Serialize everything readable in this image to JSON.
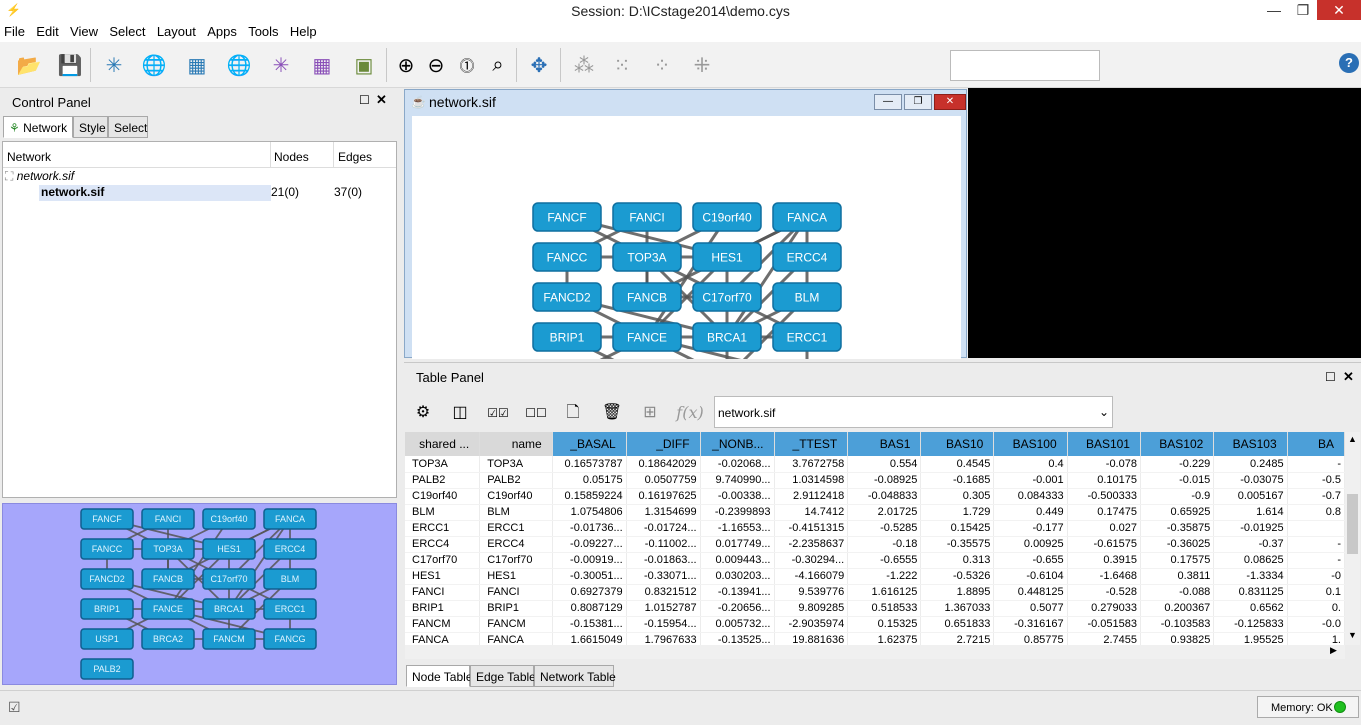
{
  "window": {
    "title": "Session: D:\\ICstage2014\\demo.cys"
  },
  "menubar": [
    "File",
    "Edit",
    "View",
    "Select",
    "Layout",
    "Apps",
    "Tools",
    "Help"
  ],
  "control_panel": {
    "title": "Control Panel",
    "tabs": [
      "Network",
      "Style",
      "Select"
    ],
    "columns": [
      "Network",
      "Nodes",
      "Edges"
    ],
    "collection_name": "network.sif",
    "network_name": "network.sif",
    "nodes": "21(0)",
    "edges": "37(0)"
  },
  "network_window": {
    "title": "network.sif"
  },
  "nodes": [
    "FANCF",
    "FANCI",
    "C19orf40",
    "FANCA",
    "FANCC",
    "TOP3A",
    "HES1",
    "ERCC4",
    "FANCD2",
    "FANCB",
    "C17orf70",
    "BLM",
    "BRIP1",
    "FANCE",
    "BRCA1",
    "ERCC1",
    "USP1",
    "BRCA2",
    "FANCM",
    "FANCG",
    "PALB2"
  ],
  "table_panel": {
    "title": "Table Panel",
    "selected_table": "network.sif",
    "function_label": "f(x)",
    "columns": [
      "shared ...",
      "name",
      "_BASAL",
      "_DIFF",
      "_NONB...",
      "_TTEST",
      "BAS1",
      "BAS10",
      "BAS100",
      "BAS101",
      "BAS102",
      "BAS103",
      "BA"
    ],
    "rows": [
      [
        "TOP3A",
        "TOP3A",
        "0.16573787",
        "0.18642029",
        "-0.02068...",
        "3.7672758",
        "0.554",
        "0.4545",
        "0.4",
        "-0.078",
        "-0.229",
        "0.2485",
        "-"
      ],
      [
        "PALB2",
        "PALB2",
        "0.05175",
        "0.0507759",
        "9.740990...",
        "1.0314598",
        "-0.08925",
        "-0.1685",
        "-0.001",
        "0.10175",
        "-0.015",
        "-0.03075",
        "-0.5"
      ],
      [
        "C19orf40",
        "C19orf40",
        "0.15859224",
        "0.16197625",
        "-0.00338...",
        "2.9112418",
        "-0.048833",
        "0.305",
        "0.084333",
        "-0.500333",
        "-0.9",
        "0.005167",
        "-0.7"
      ],
      [
        "BLM",
        "BLM",
        "1.0754806",
        "1.3154699",
        "-0.2399893",
        "14.7412",
        "2.01725",
        "1.729",
        "0.449",
        "0.17475",
        "0.65925",
        "1.614",
        "0.8"
      ],
      [
        "ERCC1",
        "ERCC1",
        "-0.01736...",
        "-0.01724...",
        "-1.16553...",
        "-0.4151315",
        "-0.5285",
        "0.15425",
        "-0.177",
        "0.027",
        "-0.35875",
        "-0.01925",
        ""
      ],
      [
        "ERCC4",
        "ERCC4",
        "-0.09227...",
        "-0.11002...",
        "0.017749...",
        "-2.2358637",
        "-0.18",
        "-0.35575",
        "0.00925",
        "-0.61575",
        "-0.36025",
        "-0.37",
        "-"
      ],
      [
        "C17orf70",
        "C17orf70",
        "-0.00919...",
        "-0.01863...",
        "0.009443...",
        "-0.30294...",
        "-0.6555",
        "0.313",
        "-0.655",
        "0.3915",
        "0.17575",
        "0.08625",
        "-"
      ],
      [
        "HES1",
        "HES1",
        "-0.30051...",
        "-0.33071...",
        "0.030203...",
        "-4.166079",
        "-1.222",
        "-0.5326",
        "-0.6104",
        "-1.6468",
        "0.3811",
        "-1.3334",
        "-0"
      ],
      [
        "FANCI",
        "FANCI",
        "0.6927379",
        "0.8321512",
        "-0.13941...",
        "9.539776",
        "1.616125",
        "1.8895",
        "0.448125",
        "-0.528",
        "-0.088",
        "0.831125",
        "0.1"
      ],
      [
        "BRIP1",
        "BRIP1",
        "0.8087129",
        "1.0152787",
        "-0.20656...",
        "9.809285",
        "0.518533",
        "1.367033",
        "0.5077",
        "0.279033",
        "0.200367",
        "0.6562",
        "0."
      ],
      [
        "FANCM",
        "FANCM",
        "-0.15381...",
        "-0.15954...",
        "0.005732...",
        "-2.9035974",
        "0.15325",
        "0.651833",
        "-0.316167",
        "-0.051583",
        "-0.103583",
        "-0.125833",
        "-0.0"
      ],
      [
        "FANCA",
        "FANCA",
        "1.6615049",
        "1.7967633",
        "-0.13525...",
        "19.881636",
        "1.62375",
        "2.7215",
        "0.85775",
        "2.7455",
        "0.93825",
        "1.95525",
        "1."
      ]
    ],
    "bottom_tabs": [
      "Node Table",
      "Edge Table",
      "Network Table"
    ]
  },
  "status": {
    "memory_label": "Memory: OK",
    "memory_color": "#1fbf1f"
  },
  "colors": {
    "node_fill": "#1b9bd1",
    "edge": "#555555",
    "birdseye_bg": "#a6a6fb",
    "table_header": "#4c9fd8"
  },
  "icons": {
    "toolbar": [
      "open-session-icon",
      "save-session-icon",
      "import-network-file-icon",
      "import-network-web-icon",
      "import-table-file-icon",
      "import-table-web-icon",
      "export-network-icon",
      "export-table-icon",
      "export-image-icon",
      "zoom-in-icon",
      "zoom-out-icon",
      "zoom-fit-icon",
      "zoom-selected-icon",
      "apply-layout-icon",
      "first-neighbors-icon",
      "hide-selected-icon",
      "show-all-icon",
      "new-network-from-selection-icon",
      "help-icon"
    ]
  }
}
